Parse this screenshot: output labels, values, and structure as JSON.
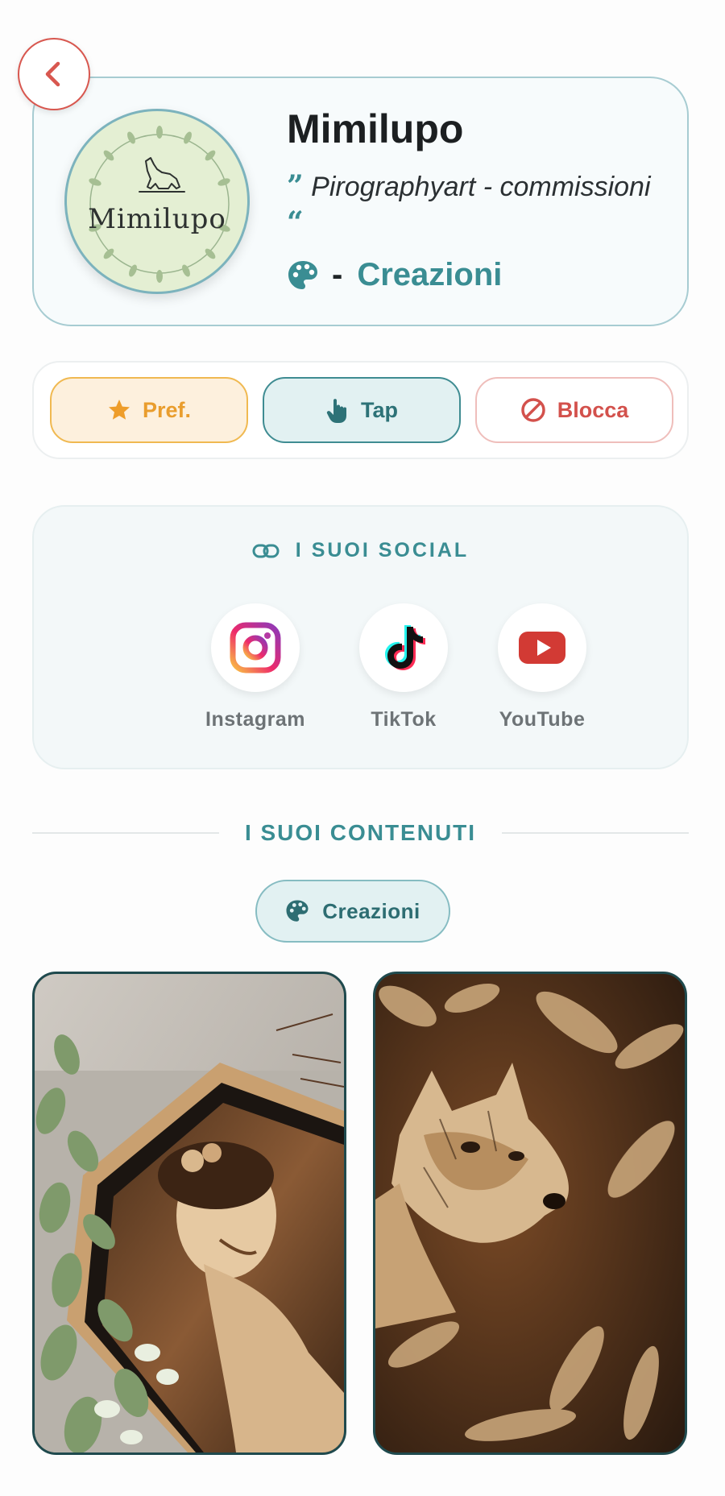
{
  "colors": {
    "accent": "#3a8d93",
    "pref": "#e99d2d",
    "block": "#d3514c",
    "back": "#d8574f"
  },
  "nav": {
    "back_icon": "chevron-left-icon"
  },
  "profile": {
    "avatar_text": "Mimilupo",
    "name": "Mimilupo",
    "quote_open": "”",
    "bio": "Pirographyart - commissioni",
    "quote_close": "“",
    "category_icon": "palette-icon",
    "category_dash": "-",
    "category": "Creazioni"
  },
  "actions": {
    "pref": {
      "label": "Pref.",
      "icon": "star-icon"
    },
    "tap": {
      "label": "Tap",
      "icon": "tap-hand-icon"
    },
    "block": {
      "label": "Blocca",
      "icon": "ban-icon"
    }
  },
  "social": {
    "heading_icon": "link-icon",
    "heading": "I SUOI SOCIAL",
    "items": [
      {
        "label": "Instagram",
        "icon": "instagram-icon"
      },
      {
        "label": "TikTok",
        "icon": "tiktok-icon"
      },
      {
        "label": "YouTube",
        "icon": "youtube-icon"
      }
    ]
  },
  "content": {
    "heading": "I SUOI CONTENUTI",
    "filter": {
      "label": "Creazioni",
      "icon": "palette-icon"
    },
    "tiles": [
      {
        "subject": "pyrography portrait of woman with flowers in frame"
      },
      {
        "subject": "pyrography wolf among leaves"
      }
    ]
  }
}
